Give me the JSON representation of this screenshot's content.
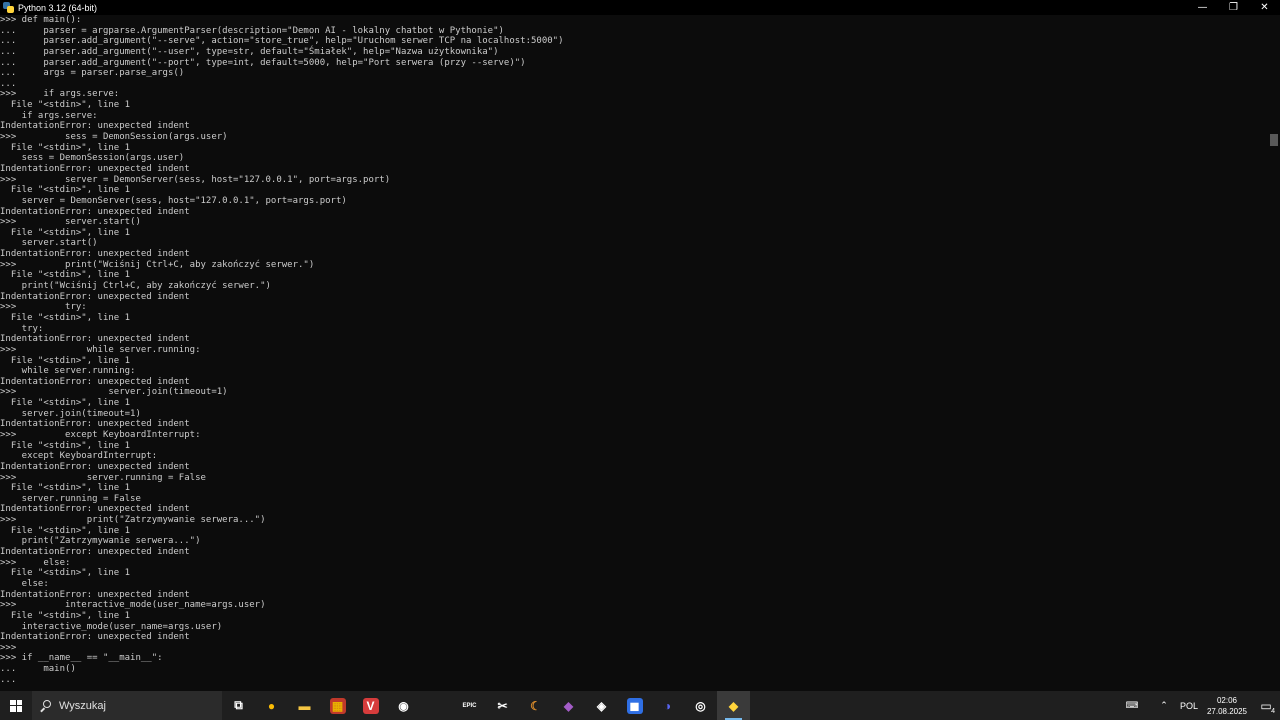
{
  "window": {
    "title": "Python 3.12 (64-bit)",
    "minimize": "—",
    "restore": "❐",
    "close": "✕"
  },
  "console_lines": [
    ">>> def main():",
    "...     parser = argparse.ArgumentParser(description=\"Demon AI - lokalny chatbot w Pythonie\")",
    "...     parser.add_argument(\"--serve\", action=\"store_true\", help=\"Uruchom serwer TCP na localhost:5000\")",
    "...     parser.add_argument(\"--user\", type=str, default=\"Śmiałek\", help=\"Nazwa użytkownika\")",
    "...     parser.add_argument(\"--port\", type=int, default=5000, help=\"Port serwera (przy --serve)\")",
    "...     args = parser.parse_args()",
    "...",
    ">>>     if args.serve:",
    "  File \"<stdin>\", line 1",
    "    if args.serve:",
    "IndentationError: unexpected indent",
    ">>>         sess = DemonSession(args.user)",
    "  File \"<stdin>\", line 1",
    "    sess = DemonSession(args.user)",
    "IndentationError: unexpected indent",
    ">>>         server = DemonServer(sess, host=\"127.0.0.1\", port=args.port)",
    "  File \"<stdin>\", line 1",
    "    server = DemonServer(sess, host=\"127.0.0.1\", port=args.port)",
    "IndentationError: unexpected indent",
    ">>>         server.start()",
    "  File \"<stdin>\", line 1",
    "    server.start()",
    "IndentationError: unexpected indent",
    ">>>         print(\"Wciśnij Ctrl+C, aby zakończyć serwer.\")",
    "  File \"<stdin>\", line 1",
    "    print(\"Wciśnij Ctrl+C, aby zakończyć serwer.\")",
    "IndentationError: unexpected indent",
    ">>>         try:",
    "  File \"<stdin>\", line 1",
    "    try:",
    "IndentationError: unexpected indent",
    ">>>             while server.running:",
    "  File \"<stdin>\", line 1",
    "    while server.running:",
    "IndentationError: unexpected indent",
    ">>>                 server.join(timeout=1)",
    "  File \"<stdin>\", line 1",
    "    server.join(timeout=1)",
    "IndentationError: unexpected indent",
    ">>>         except KeyboardInterrupt:",
    "  File \"<stdin>\", line 1",
    "    except KeyboardInterrupt:",
    "IndentationError: unexpected indent",
    ">>>             server.running = False",
    "  File \"<stdin>\", line 1",
    "    server.running = False",
    "IndentationError: unexpected indent",
    ">>>             print(\"Zatrzymywanie serwera...\")",
    "  File \"<stdin>\", line 1",
    "    print(\"Zatrzymywanie serwera...\")",
    "IndentationError: unexpected indent",
    ">>>     else:",
    "  File \"<stdin>\", line 1",
    "    else:",
    "IndentationError: unexpected indent",
    ">>>         interactive_mode(user_name=args.user)",
    "  File \"<stdin>\", line 1",
    "    interactive_mode(user_name=args.user)",
    "IndentationError: unexpected indent",
    ">>>",
    ">>> if __name__ == \"__main__\":",
    "...     main()",
    "..."
  ],
  "taskbar": {
    "search_placeholder": "Wyszukaj",
    "apps": [
      {
        "name": "task-view-icon",
        "glyph": "⧉",
        "color": "#ffffff",
        "bg": "transparent"
      },
      {
        "name": "chrome-icon",
        "glyph": "●",
        "color": "#fbbc05",
        "bg": "transparent"
      },
      {
        "name": "file-explorer-icon",
        "glyph": "▬",
        "color": "#f4c542",
        "bg": "transparent"
      },
      {
        "name": "mahjong-icon",
        "glyph": "▦",
        "color": "#e8b100",
        "bg": "#c0392b"
      },
      {
        "name": "vegas-icon",
        "glyph": "V",
        "color": "#ffffff",
        "bg": "#d63c3c"
      },
      {
        "name": "obs-icon",
        "glyph": "◉",
        "color": "#ffffff",
        "bg": "transparent"
      },
      {
        "name": "blank-app-icon",
        "glyph": "",
        "color": "#444444",
        "bg": "transparent"
      },
      {
        "name": "epic-games-icon",
        "glyph": "EPIC",
        "color": "#ffffff",
        "bg": "transparent"
      },
      {
        "name": "capcut-icon",
        "glyph": "✂",
        "color": "#ffffff",
        "bg": "transparent"
      },
      {
        "name": "crescent-app-icon",
        "glyph": "☾",
        "color": "#d98b2b",
        "bg": "transparent"
      },
      {
        "name": "visual-studio-icon",
        "glyph": "◆",
        "color": "#a45dc8",
        "bg": "transparent"
      },
      {
        "name": "steam-icon",
        "glyph": "◈",
        "color": "#ffffff",
        "bg": "transparent"
      },
      {
        "name": "notes-app-icon",
        "glyph": "◼",
        "color": "#ffffff",
        "bg": "#2f6fe4"
      },
      {
        "name": "discord-icon",
        "glyph": "◑",
        "color": "#5865f2",
        "bg": "transparent"
      },
      {
        "name": "github-icon",
        "glyph": "◎",
        "color": "#ffffff",
        "bg": "transparent"
      },
      {
        "name": "python-icon",
        "glyph": "◆",
        "color": "#ffd43b",
        "bg": "transparent",
        "active": true
      }
    ],
    "tray": {
      "chevron": "⌃",
      "language": "POL",
      "time": "02:06",
      "date": "27.08.2025",
      "notifications": "4",
      "keyboard_glyph": "⌨",
      "notif_glyph": "▭"
    }
  }
}
